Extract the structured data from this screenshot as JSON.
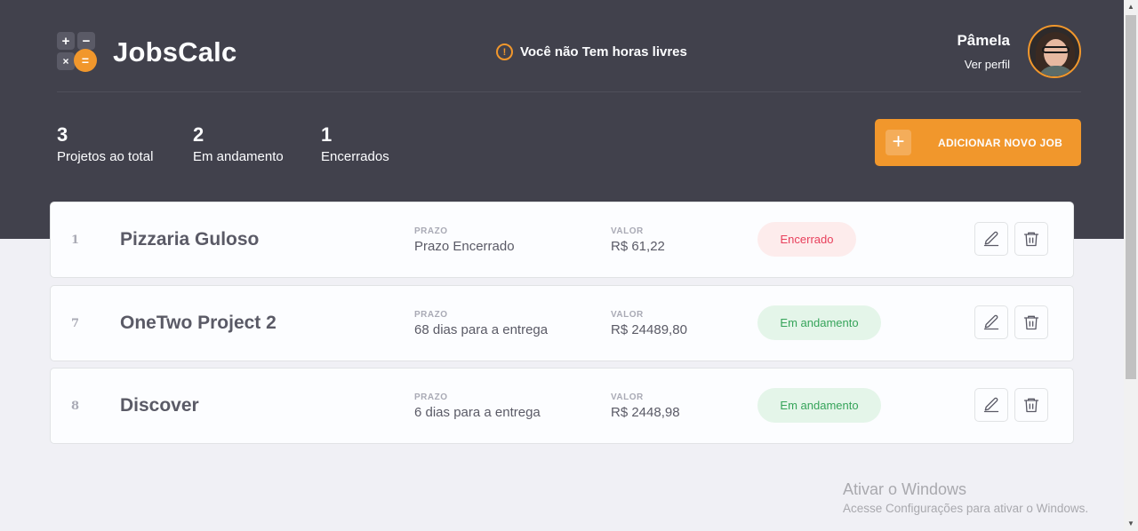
{
  "header": {
    "logo_plus": "+",
    "logo_minus": "−",
    "logo_times": "×",
    "logo_equals": "=",
    "app_name": "JobsCalc",
    "free_hours_icon": "!",
    "free_hours_text": "Você não Tem horas livres",
    "profile_name": "Pâmela",
    "profile_link": "Ver perfil"
  },
  "stats": [
    {
      "value": "3",
      "label": "Projetos ao total"
    },
    {
      "value": "2",
      "label": "Em andamento"
    },
    {
      "value": "1",
      "label": "Encerrados"
    }
  ],
  "add_button": {
    "icon": "+",
    "label": "ADICIONAR NOVO JOB"
  },
  "jobs": [
    {
      "id": "1",
      "name": "Pizzaria Guloso",
      "deadline_label": "PRAZO",
      "deadline": "Prazo Encerrado",
      "value_label": "VALOR",
      "value": "R$ 61,22",
      "status": "Encerrado"
    },
    {
      "id": "7",
      "name": "OneTwo Project 2",
      "deadline_label": "PRAZO",
      "deadline": "68 dias para a entrega",
      "value_label": "VALOR",
      "value": "R$ 24489,80",
      "status": "Em andamento"
    },
    {
      "id": "8",
      "name": "Discover",
      "deadline_label": "PRAZO",
      "deadline": "6 dias para a entrega",
      "value_label": "VALOR",
      "value": "R$ 2448,98",
      "status": "Em andamento"
    }
  ],
  "watermark": {
    "line1": "Ativar o Windows",
    "line2": "Acesse Configurações para ativar o Windows."
  },
  "colors": {
    "header_bg": "#41414C",
    "accent": "#F1972C",
    "page_bg": "#F0F0F5",
    "status_done": "#E83F5B",
    "status_progress": "#36A45A"
  },
  "icons": {
    "edit": "pencil-icon",
    "delete": "trash-icon",
    "alert": "alert-circle-icon",
    "add": "plus-icon"
  }
}
